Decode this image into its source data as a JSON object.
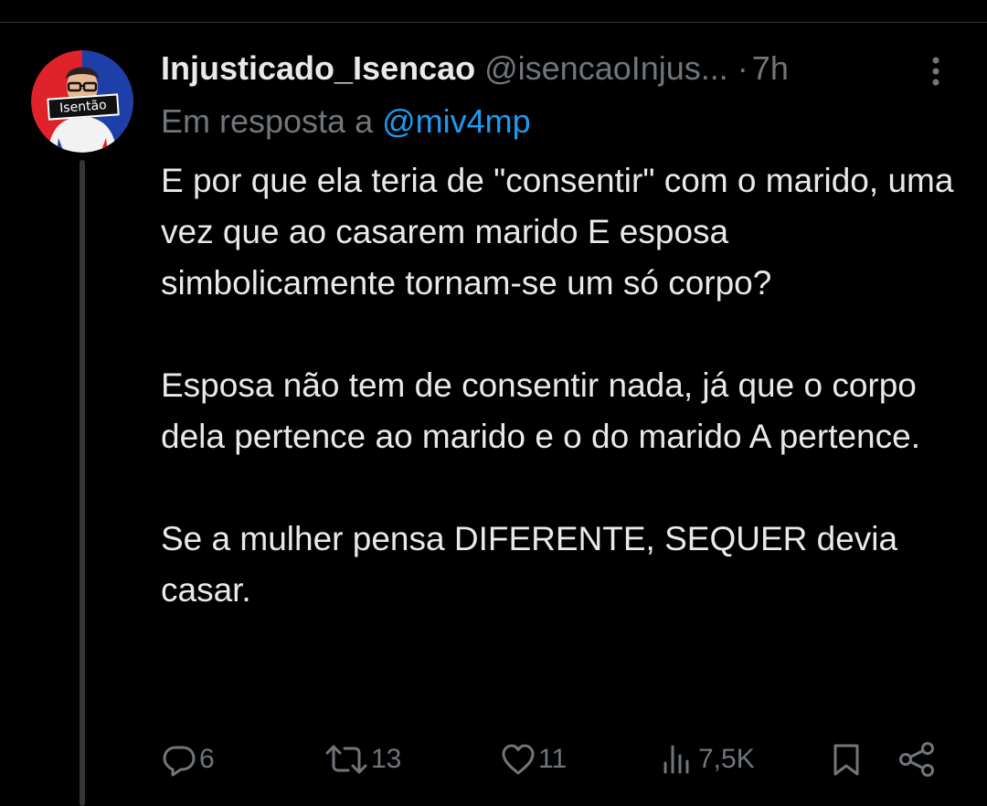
{
  "tweet": {
    "author": {
      "display_name": "Injusticado_Isencao",
      "handle": "@isencaoInjus...",
      "avatar_badge_text": "Isentão"
    },
    "separator": "·",
    "timestamp": "7h",
    "reply_to": {
      "prefix": "Em resposta a",
      "mention": "@miv4mp"
    },
    "paragraphs": [
      "E por que ela teria de \"consentir\" com o marido, uma vez que ao casarem marido E esposa simbolicamente tornam-se um só corpo?",
      "Esposa não tem de consentir nada, já que o corpo dela pertence ao marido e o do marido A pertence.",
      "Se a mulher pensa DIFERENTE, SEQUER devia casar."
    ],
    "actions": {
      "replies": "6",
      "reposts": "13",
      "likes": "11",
      "views": "7,5K"
    }
  },
  "icons": {
    "more": "more-vertical-icon",
    "reply": "reply-bubble-icon",
    "repost": "repost-arrows-icon",
    "like": "heart-icon",
    "views": "views-bar-chart-icon",
    "bookmark": "bookmark-icon",
    "share": "share-icon"
  },
  "colors": {
    "background": "#000000",
    "text_primary": "#e7e9ea",
    "text_secondary": "#71767b",
    "accent_link": "#1d9bf0",
    "thread_line": "#333639"
  }
}
